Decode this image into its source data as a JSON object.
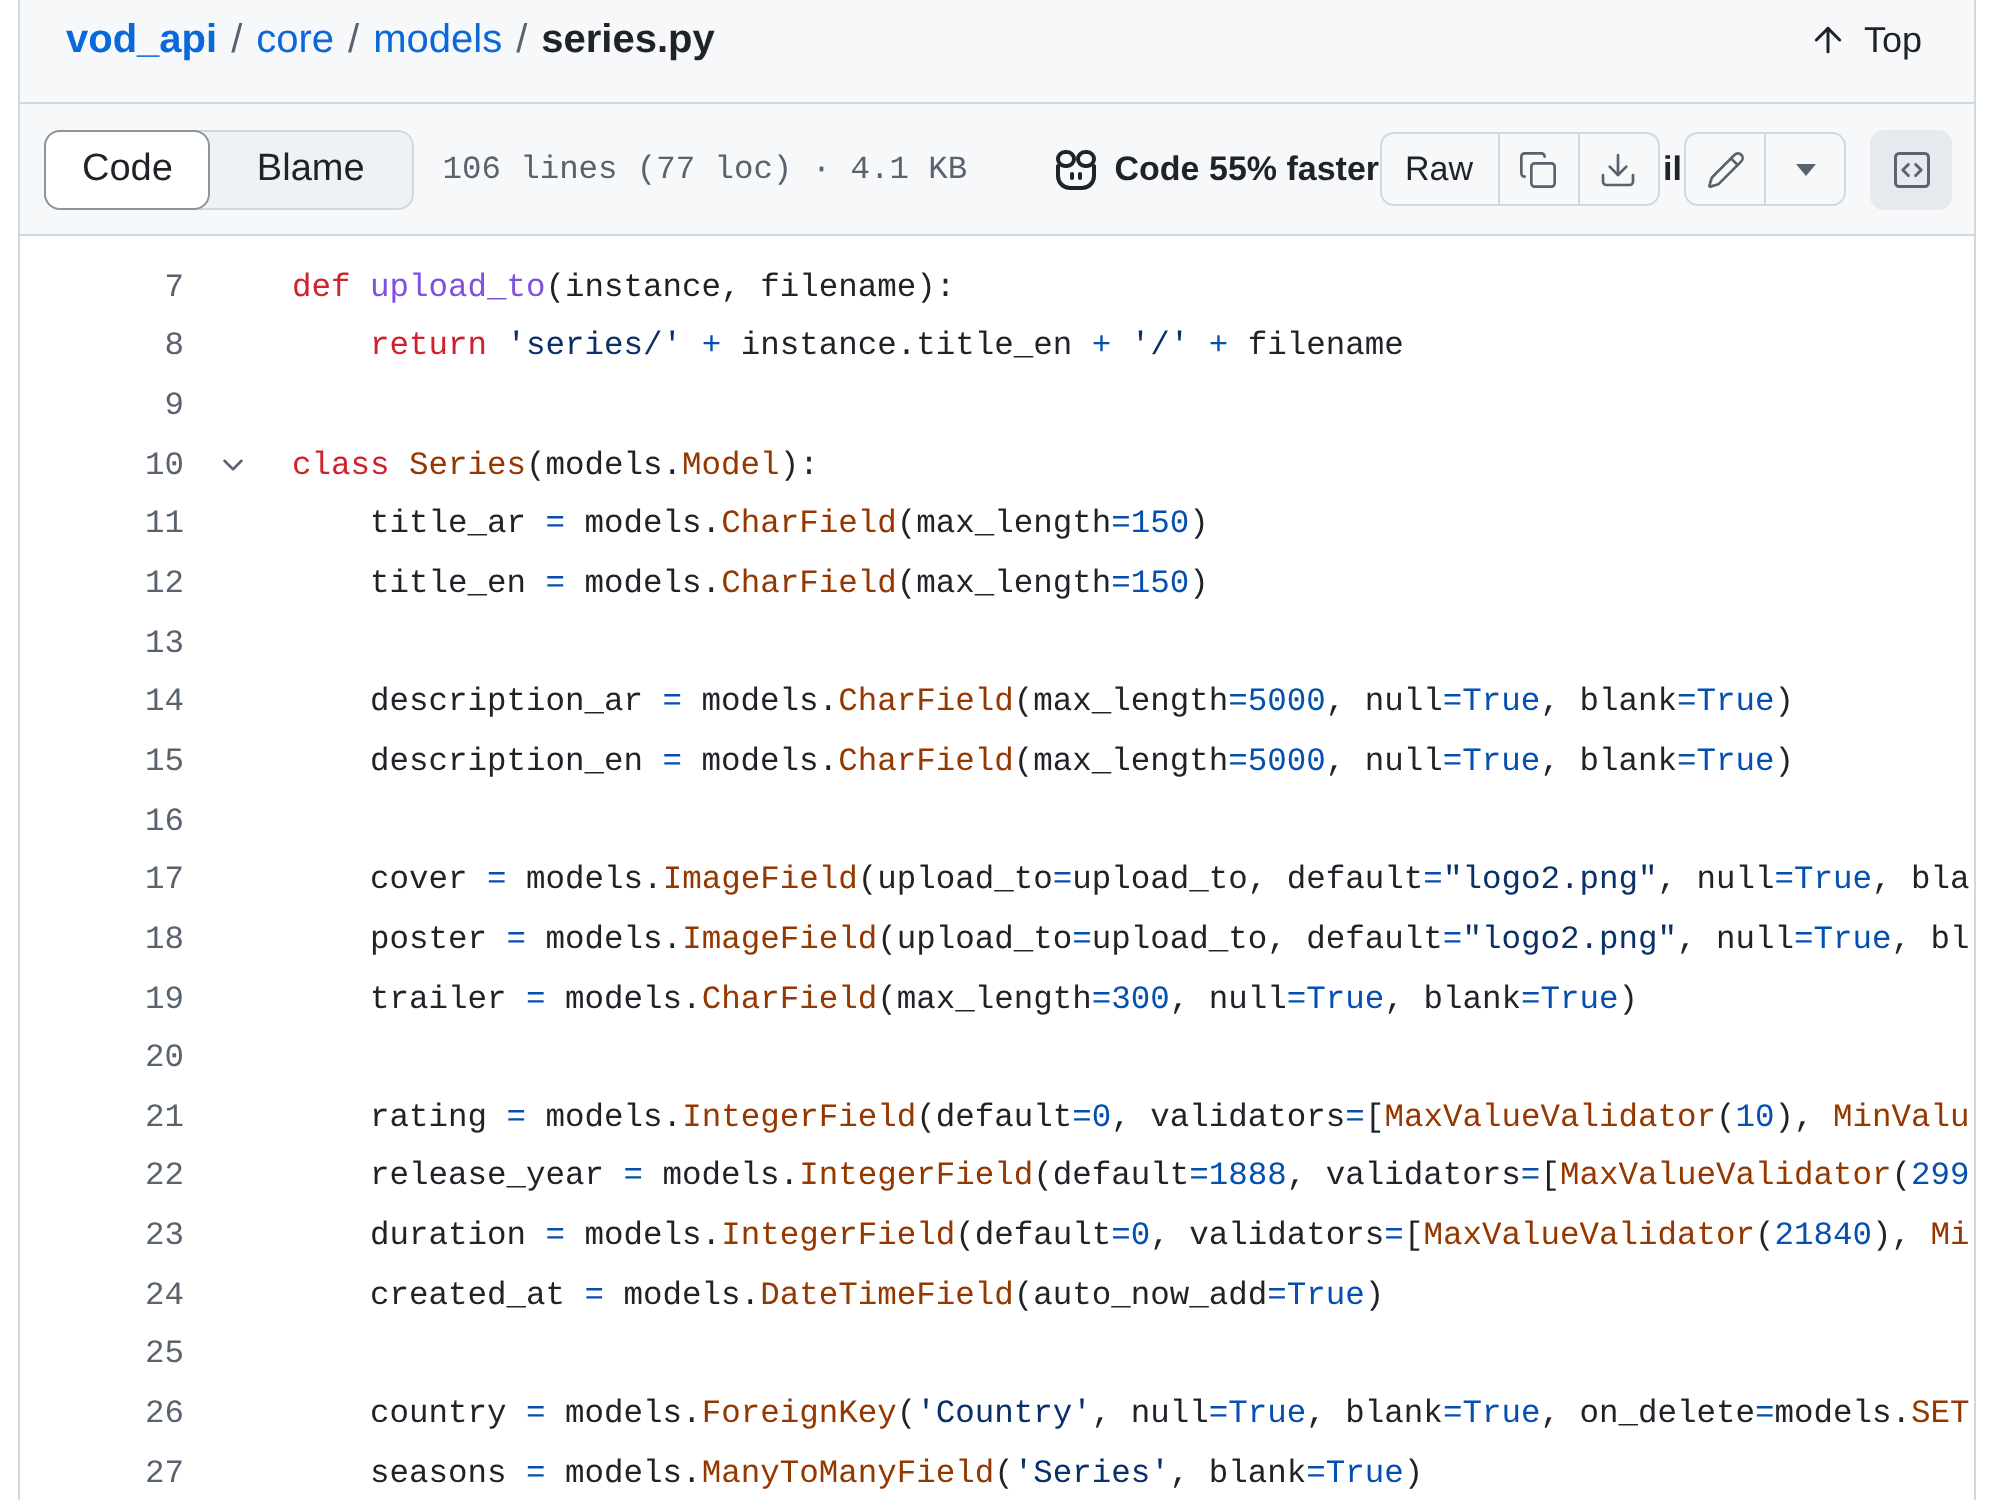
{
  "breadcrumb": [
    {
      "kind": "repo",
      "text": "vod_api",
      "separator": "/"
    },
    {
      "kind": "link",
      "text": "core",
      "separator": "/"
    },
    {
      "kind": "link",
      "text": "models",
      "separator": "/"
    },
    {
      "kind": "current",
      "text": "series.py"
    }
  ],
  "top_link": {
    "label": "Top"
  },
  "toolbar": {
    "view_tabs": [
      {
        "label": "Code",
        "selected": true
      },
      {
        "label": "Blame",
        "selected": false
      }
    ],
    "file_stats": "106 lines (77 loc) · 4.1 KB",
    "copilot_promo": {
      "label": "Code 55% faster",
      "label_tail": "il"
    },
    "raw_button": {
      "label": "Raw"
    }
  },
  "lines": [
    {
      "number": "7",
      "tokens": [
        {
          "kind": "keyword",
          "text": "def"
        },
        {
          "kind": "function",
          "text": " upload_to"
        },
        {
          "kind": "plain",
          "text": "(instance, filename):"
        }
      ]
    },
    {
      "number": "8",
      "tokens": [
        {
          "kind": "keyword",
          "text": "    return"
        },
        {
          "kind": "string",
          "text": " 'series/'"
        },
        {
          "kind": "operator",
          "text": " +"
        },
        {
          "kind": "plain",
          "text": " instance.title_en "
        },
        {
          "kind": "operator",
          "text": "+"
        },
        {
          "kind": "string",
          "text": " '/'"
        },
        {
          "kind": "operator",
          "text": " +"
        },
        {
          "kind": "plain",
          "text": " filename"
        }
      ]
    },
    {
      "number": "9"
    },
    {
      "number": "10",
      "fold": {
        "expanded": true
      },
      "tokens": [
        {
          "kind": "keyword",
          "text": "class"
        },
        {
          "kind": "entity",
          "text": " Series"
        },
        {
          "kind": "plain",
          "text": "(models."
        },
        {
          "kind": "entity",
          "text": "Model"
        },
        {
          "kind": "plain",
          "text": "):"
        }
      ]
    },
    {
      "number": "11",
      "tokens": [
        {
          "kind": "plain",
          "text": "    title_ar "
        },
        {
          "kind": "operator",
          "text": "="
        },
        {
          "kind": "plain",
          "text": " models."
        },
        {
          "kind": "entity",
          "text": "CharField"
        },
        {
          "kind": "plain",
          "text": "(max_length"
        },
        {
          "kind": "operator",
          "text": "="
        },
        {
          "kind": "constant",
          "text": "150"
        },
        {
          "kind": "plain",
          "text": ")"
        }
      ]
    },
    {
      "number": "12",
      "tokens": [
        {
          "kind": "plain",
          "text": "    title_en "
        },
        {
          "kind": "operator",
          "text": "="
        },
        {
          "kind": "plain",
          "text": " models."
        },
        {
          "kind": "entity",
          "text": "CharField"
        },
        {
          "kind": "plain",
          "text": "(max_length"
        },
        {
          "kind": "operator",
          "text": "="
        },
        {
          "kind": "constant",
          "text": "150"
        },
        {
          "kind": "plain",
          "text": ")"
        }
      ]
    },
    {
      "number": "13"
    },
    {
      "number": "14",
      "tokens": [
        {
          "kind": "plain",
          "text": "    description_ar "
        },
        {
          "kind": "operator",
          "text": "="
        },
        {
          "kind": "plain",
          "text": " models."
        },
        {
          "kind": "entity",
          "text": "CharField"
        },
        {
          "kind": "plain",
          "text": "(max_length"
        },
        {
          "kind": "operator",
          "text": "="
        },
        {
          "kind": "constant",
          "text": "5000"
        },
        {
          "kind": "plain",
          "text": ", null"
        },
        {
          "kind": "operator",
          "text": "="
        },
        {
          "kind": "constant",
          "text": "True"
        },
        {
          "kind": "plain",
          "text": ", blank"
        },
        {
          "kind": "operator",
          "text": "="
        },
        {
          "kind": "constant",
          "text": "True"
        },
        {
          "kind": "plain",
          "text": ")"
        }
      ]
    },
    {
      "number": "15",
      "tokens": [
        {
          "kind": "plain",
          "text": "    description_en "
        },
        {
          "kind": "operator",
          "text": "="
        },
        {
          "kind": "plain",
          "text": " models."
        },
        {
          "kind": "entity",
          "text": "CharField"
        },
        {
          "kind": "plain",
          "text": "(max_length"
        },
        {
          "kind": "operator",
          "text": "="
        },
        {
          "kind": "constant",
          "text": "5000"
        },
        {
          "kind": "plain",
          "text": ", null"
        },
        {
          "kind": "operator",
          "text": "="
        },
        {
          "kind": "constant",
          "text": "True"
        },
        {
          "kind": "plain",
          "text": ", blank"
        },
        {
          "kind": "operator",
          "text": "="
        },
        {
          "kind": "constant",
          "text": "True"
        },
        {
          "kind": "plain",
          "text": ")"
        }
      ]
    },
    {
      "number": "16"
    },
    {
      "number": "17",
      "tokens": [
        {
          "kind": "plain",
          "text": "    cover "
        },
        {
          "kind": "operator",
          "text": "="
        },
        {
          "kind": "plain",
          "text": " models."
        },
        {
          "kind": "entity",
          "text": "ImageField"
        },
        {
          "kind": "plain",
          "text": "(upload_to"
        },
        {
          "kind": "operator",
          "text": "="
        },
        {
          "kind": "plain",
          "text": "upload_to, default"
        },
        {
          "kind": "operator",
          "text": "="
        },
        {
          "kind": "string",
          "text": "\"logo2.png\""
        },
        {
          "kind": "plain",
          "text": ", null"
        },
        {
          "kind": "operator",
          "text": "="
        },
        {
          "kind": "constant",
          "text": "True"
        },
        {
          "kind": "plain",
          "text": ", bla"
        }
      ]
    },
    {
      "number": "18",
      "tokens": [
        {
          "kind": "plain",
          "text": "    poster "
        },
        {
          "kind": "operator",
          "text": "="
        },
        {
          "kind": "plain",
          "text": " models."
        },
        {
          "kind": "entity",
          "text": "ImageField"
        },
        {
          "kind": "plain",
          "text": "(upload_to"
        },
        {
          "kind": "operator",
          "text": "="
        },
        {
          "kind": "plain",
          "text": "upload_to, default"
        },
        {
          "kind": "operator",
          "text": "="
        },
        {
          "kind": "string",
          "text": "\"logo2.png\""
        },
        {
          "kind": "plain",
          "text": ", null"
        },
        {
          "kind": "operator",
          "text": "="
        },
        {
          "kind": "constant",
          "text": "True"
        },
        {
          "kind": "plain",
          "text": ", bl"
        }
      ]
    },
    {
      "number": "19",
      "tokens": [
        {
          "kind": "plain",
          "text": "    trailer "
        },
        {
          "kind": "operator",
          "text": "="
        },
        {
          "kind": "plain",
          "text": " models."
        },
        {
          "kind": "entity",
          "text": "CharField"
        },
        {
          "kind": "plain",
          "text": "(max_length"
        },
        {
          "kind": "operator",
          "text": "="
        },
        {
          "kind": "constant",
          "text": "300"
        },
        {
          "kind": "plain",
          "text": ", null"
        },
        {
          "kind": "operator",
          "text": "="
        },
        {
          "kind": "constant",
          "text": "True"
        },
        {
          "kind": "plain",
          "text": ", blank"
        },
        {
          "kind": "operator",
          "text": "="
        },
        {
          "kind": "constant",
          "text": "True"
        },
        {
          "kind": "plain",
          "text": ")"
        }
      ]
    },
    {
      "number": "20"
    },
    {
      "number": "21",
      "tokens": [
        {
          "kind": "plain",
          "text": "    rating "
        },
        {
          "kind": "operator",
          "text": "="
        },
        {
          "kind": "plain",
          "text": " models."
        },
        {
          "kind": "entity",
          "text": "IntegerField"
        },
        {
          "kind": "plain",
          "text": "(default"
        },
        {
          "kind": "operator",
          "text": "="
        },
        {
          "kind": "constant",
          "text": "0"
        },
        {
          "kind": "plain",
          "text": ", validators"
        },
        {
          "kind": "operator",
          "text": "="
        },
        {
          "kind": "plain",
          "text": "["
        },
        {
          "kind": "entity",
          "text": "MaxValueValidator"
        },
        {
          "kind": "plain",
          "text": "("
        },
        {
          "kind": "constant",
          "text": "10"
        },
        {
          "kind": "plain",
          "text": "), "
        },
        {
          "kind": "entity",
          "text": "MinValu"
        }
      ]
    },
    {
      "number": "22",
      "tokens": [
        {
          "kind": "plain",
          "text": "    release_year "
        },
        {
          "kind": "operator",
          "text": "="
        },
        {
          "kind": "plain",
          "text": " models."
        },
        {
          "kind": "entity",
          "text": "IntegerField"
        },
        {
          "kind": "plain",
          "text": "(default"
        },
        {
          "kind": "operator",
          "text": "="
        },
        {
          "kind": "constant",
          "text": "1888"
        },
        {
          "kind": "plain",
          "text": ", validators"
        },
        {
          "kind": "operator",
          "text": "="
        },
        {
          "kind": "plain",
          "text": "["
        },
        {
          "kind": "entity",
          "text": "MaxValueValidator"
        },
        {
          "kind": "plain",
          "text": "("
        },
        {
          "kind": "constant",
          "text": "299"
        }
      ]
    },
    {
      "number": "23",
      "tokens": [
        {
          "kind": "plain",
          "text": "    duration "
        },
        {
          "kind": "operator",
          "text": "="
        },
        {
          "kind": "plain",
          "text": " models."
        },
        {
          "kind": "entity",
          "text": "IntegerField"
        },
        {
          "kind": "plain",
          "text": "(default"
        },
        {
          "kind": "operator",
          "text": "="
        },
        {
          "kind": "constant",
          "text": "0"
        },
        {
          "kind": "plain",
          "text": ", validators"
        },
        {
          "kind": "operator",
          "text": "="
        },
        {
          "kind": "plain",
          "text": "["
        },
        {
          "kind": "entity",
          "text": "MaxValueValidator"
        },
        {
          "kind": "plain",
          "text": "("
        },
        {
          "kind": "constant",
          "text": "21840"
        },
        {
          "kind": "plain",
          "text": "), "
        },
        {
          "kind": "entity",
          "text": "Mi"
        }
      ]
    },
    {
      "number": "24",
      "tokens": [
        {
          "kind": "plain",
          "text": "    created_at "
        },
        {
          "kind": "operator",
          "text": "="
        },
        {
          "kind": "plain",
          "text": " models."
        },
        {
          "kind": "entity",
          "text": "DateTimeField"
        },
        {
          "kind": "plain",
          "text": "(auto_now_add"
        },
        {
          "kind": "operator",
          "text": "="
        },
        {
          "kind": "constant",
          "text": "True"
        },
        {
          "kind": "plain",
          "text": ")"
        }
      ]
    },
    {
      "number": "25"
    },
    {
      "number": "26",
      "tokens": [
        {
          "kind": "plain",
          "text": "    country "
        },
        {
          "kind": "operator",
          "text": "="
        },
        {
          "kind": "plain",
          "text": " models."
        },
        {
          "kind": "entity",
          "text": "ForeignKey"
        },
        {
          "kind": "plain",
          "text": "("
        },
        {
          "kind": "string",
          "text": "'Country'"
        },
        {
          "kind": "plain",
          "text": ", null"
        },
        {
          "kind": "operator",
          "text": "="
        },
        {
          "kind": "constant",
          "text": "True"
        },
        {
          "kind": "plain",
          "text": ", blank"
        },
        {
          "kind": "operator",
          "text": "="
        },
        {
          "kind": "constant",
          "text": "True"
        },
        {
          "kind": "plain",
          "text": ", on_delete"
        },
        {
          "kind": "operator",
          "text": "="
        },
        {
          "kind": "plain",
          "text": "models."
        },
        {
          "kind": "entity",
          "text": "SET"
        }
      ]
    },
    {
      "number": "27",
      "tokens": [
        {
          "kind": "plain",
          "text": "    seasons "
        },
        {
          "kind": "operator",
          "text": "="
        },
        {
          "kind": "plain",
          "text": " models."
        },
        {
          "kind": "entity",
          "text": "ManyToManyField"
        },
        {
          "kind": "plain",
          "text": "("
        },
        {
          "kind": "string",
          "text": "'Series'"
        },
        {
          "kind": "plain",
          "text": ", blank"
        },
        {
          "kind": "operator",
          "text": "="
        },
        {
          "kind": "constant",
          "text": "True"
        },
        {
          "kind": "plain",
          "text": ")"
        }
      ]
    }
  ]
}
